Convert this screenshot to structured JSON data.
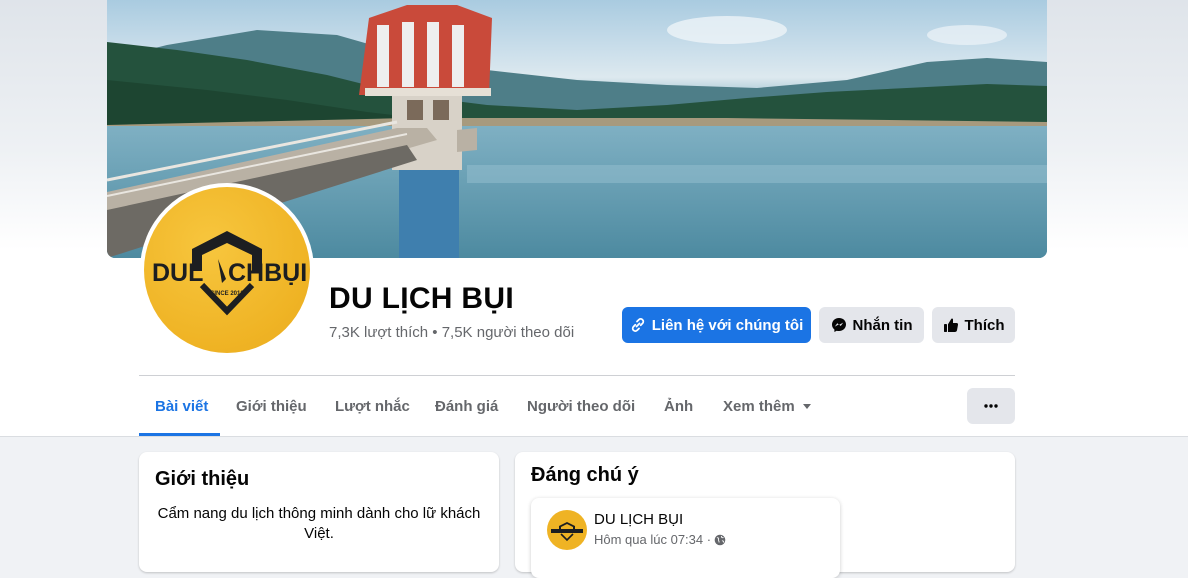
{
  "page": {
    "name": "DU LỊCH BỤI",
    "likes": "7,3K lượt thích",
    "separator": "•",
    "followers": "7,5K người theo dõi"
  },
  "logo": {
    "text_left": "DUL",
    "text_right": "CHBỤI",
    "since": "SINCE 2013"
  },
  "actions": {
    "contact_label": "Liên hệ với chúng tôi",
    "message_label": "Nhắn tin",
    "like_label": "Thích"
  },
  "tabs": [
    {
      "label": "Bài viết",
      "active": true
    },
    {
      "label": "Giới thiệu"
    },
    {
      "label": "Lượt nhắc"
    },
    {
      "label": "Đánh giá"
    },
    {
      "label": "Người theo dõi"
    },
    {
      "label": "Ảnh"
    },
    {
      "label": "Xem thêm"
    }
  ],
  "intro": {
    "title": "Giới thiệu",
    "description": "Cẩm nang du lịch thông minh dành cho lữ khách Việt."
  },
  "featured": {
    "title": "Đáng chú ý",
    "post": {
      "author": "DU LỊCH BỤI",
      "time": "Hôm qua lúc 07:34 ·"
    }
  },
  "colors": {
    "accent": "#1b74e4",
    "logo_yellow": "#efb324",
    "logo_dark": "#1c1e21"
  }
}
